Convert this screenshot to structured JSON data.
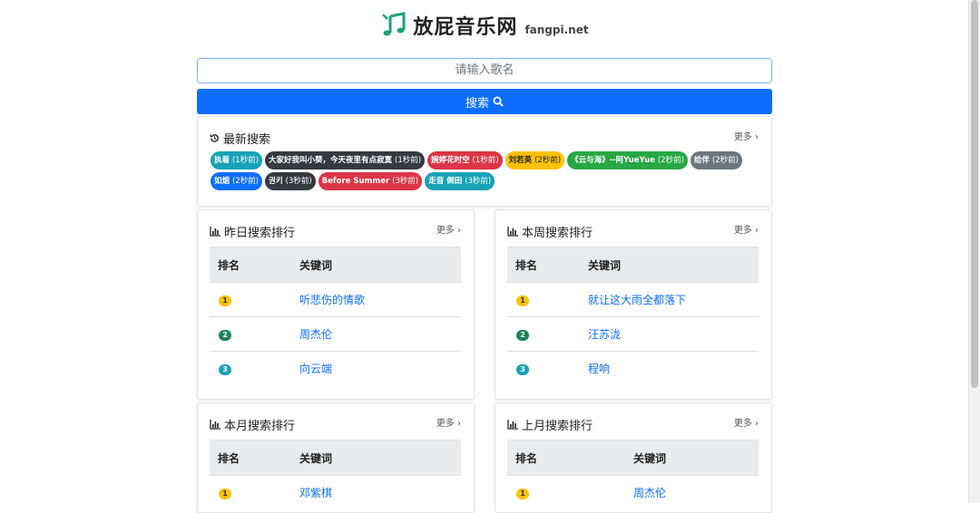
{
  "header": {
    "brand": "放屁音乐网",
    "domain": "fangpi.net",
    "logo_icon": "music-note-icon"
  },
  "search": {
    "placeholder": "请输入歌名",
    "button_label": "搜索",
    "button_icon": "search-icon"
  },
  "latest": {
    "title": "最新搜索",
    "icon": "history-icon",
    "more": "更多",
    "tags": [
      {
        "term": "执着",
        "ago": "(1秒前)",
        "color": "#17a2b8"
      },
      {
        "term": "大家好我叫小葵，今天夜里有点寂寞",
        "ago": "(1秒前)",
        "color": "#343a40"
      },
      {
        "term": "婉婷花时空",
        "ago": "(1秒前)",
        "color": "#dc3545"
      },
      {
        "term": "刘若英",
        "ago": "(2秒前)",
        "color": "#ffc107",
        "text": "#212529"
      },
      {
        "term": "《云与海》--阿YueYue",
        "ago": "(2秒前)",
        "color": "#28a745"
      },
      {
        "term": "给伴",
        "ago": "(2秒前)",
        "color": "#6c757d"
      },
      {
        "term": "如烟",
        "ago": "(2秒前)",
        "color": "#0d6efd"
      },
      {
        "term": "권키",
        "ago": "(3秒前)",
        "color": "#343a40"
      },
      {
        "term": "Before Summer",
        "ago": "(3秒前)",
        "color": "#dc3545"
      },
      {
        "term": "走音 倒田",
        "ago": "(3秒前)",
        "color": "#17a2b8"
      }
    ]
  },
  "col_header": {
    "rank": "排名",
    "keyword": "关键词"
  },
  "yesterday": {
    "title": "昨日搜索排行",
    "more": "更多",
    "rows": [
      {
        "rank": "1",
        "kw": "听悲伤的情歌"
      },
      {
        "rank": "2",
        "kw": "周杰伦"
      },
      {
        "rank": "3",
        "kw": "向云端"
      }
    ]
  },
  "week": {
    "title": "本周搜索排行",
    "more": "更多",
    "rows": [
      {
        "rank": "1",
        "kw": "就让这大雨全都落下"
      },
      {
        "rank": "2",
        "kw": "汪苏泷"
      },
      {
        "rank": "3",
        "kw": "程响"
      }
    ]
  },
  "month": {
    "title": "本月搜索排行",
    "more": "更多",
    "rows": [
      {
        "rank": "1",
        "kw": "邓紫棋"
      }
    ]
  },
  "lastmonth": {
    "title": "上月搜索排行",
    "more": "更多",
    "rows": [
      {
        "rank": "1",
        "kw": "周杰伦"
      }
    ]
  }
}
